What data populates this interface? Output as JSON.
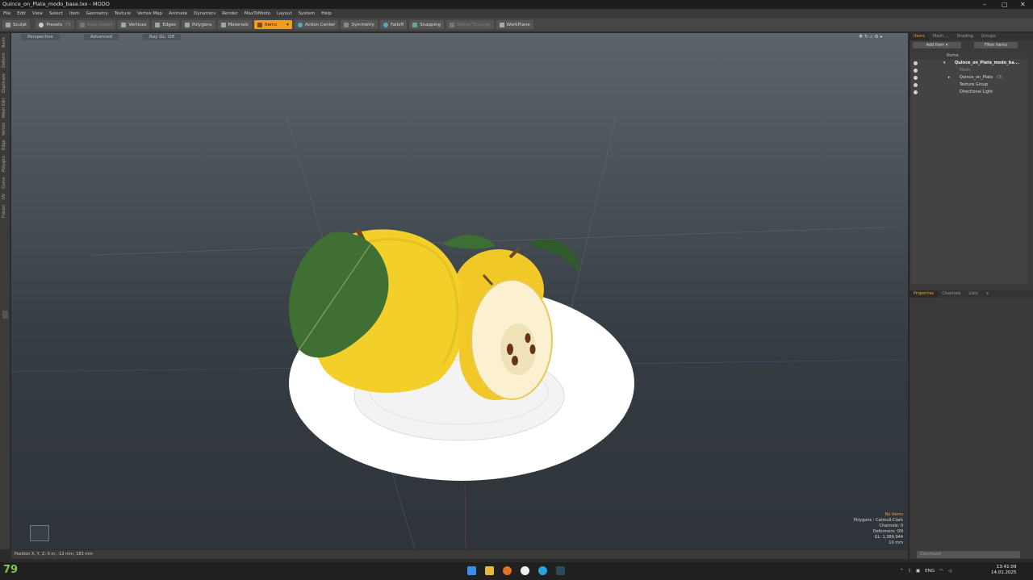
{
  "window": {
    "title": "Quince_on_Plate_modo_base.lxo - MODO"
  },
  "menu": [
    "File",
    "Edit",
    "View",
    "Select",
    "Item",
    "Geometry",
    "Texture",
    "Vertex Map",
    "Animate",
    "Dynamics",
    "Render",
    "MaxToModo",
    "Layout",
    "System",
    "Help"
  ],
  "toolbar": {
    "sculpt": "Sculpt",
    "presets": "Presets",
    "presets_key": "F6",
    "auto_select": "Auto Select",
    "vertices": "Vertices",
    "edges": "Edges",
    "polygons": "Polygons",
    "materials": "Materials",
    "items": "Items",
    "action_center": "Action Center",
    "symmetry": "Symmetry",
    "falloff": "Falloff",
    "snapping": "Snapping",
    "select_through": "Select Through",
    "workplane": "WorkPlane"
  },
  "left_tabs": [
    "Basic",
    "Deform",
    "Duplicate",
    "Mesh Edit",
    "Vertex",
    "Edge",
    "Polygon",
    "Curve",
    "UV",
    "Fusion"
  ],
  "viewport": {
    "view": "Perspective",
    "shading": "Advanced",
    "ray_gl": "Ray GL: Off"
  },
  "hud": {
    "no_items": "No Items",
    "polygons": "Polygons : Catmull-Clark",
    "channels": "Channels: 0",
    "deformers": "Deformers: ON",
    "gl": "GL: 1,369,944",
    "grid": "10 mm"
  },
  "status": {
    "position": "Position X, Y, Z:   0 m, -12 mm, 183 mm"
  },
  "items_panel": {
    "tabs": [
      "Items",
      "Mesh ...",
      "Shading",
      "Groups"
    ],
    "add_item": "Add Item",
    "filter_items": "Filter Items",
    "column_name": "Name",
    "rows": [
      {
        "label": "Quince_on_Plate_modo_ba...",
        "bold": true
      },
      {
        "label": "Mesh",
        "dim": true
      },
      {
        "label": "Quince_on_Plate",
        "suffix": "(3)"
      },
      {
        "label": "Texture Group"
      },
      {
        "label": "Directional Light"
      }
    ]
  },
  "properties_panel": {
    "tabs": [
      "Properties",
      "Channels",
      "Lists",
      "+"
    ]
  },
  "command": {
    "placeholder": "Command"
  },
  "taskbar": {
    "temperature": "79",
    "lang": "ENG",
    "time": "13:41:09",
    "date": "14.01.2025"
  },
  "colors": {
    "accent": "#f29c1e",
    "quince": "#f3cf2a",
    "leaf": "#3f6f33",
    "plate": "#ffffff"
  }
}
